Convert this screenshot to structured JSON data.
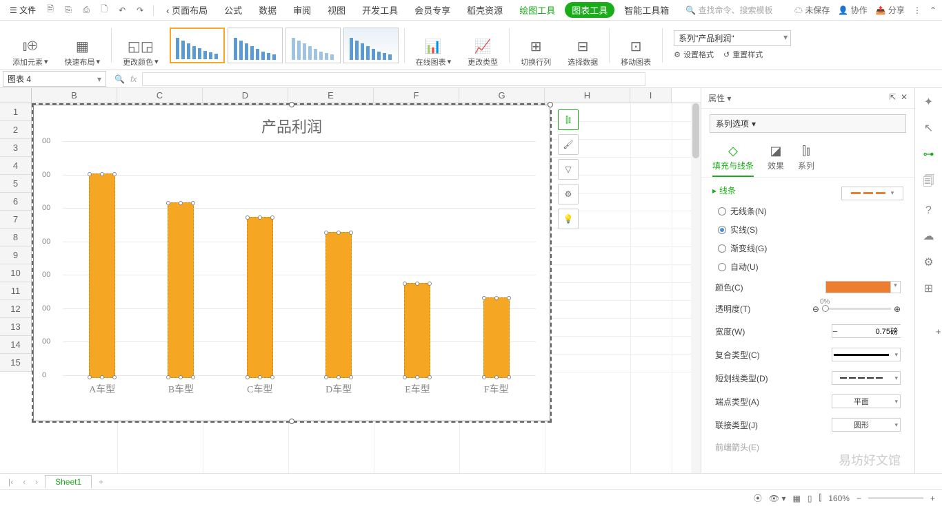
{
  "topbar": {
    "file": "文件",
    "tabs": [
      "页面布局",
      "公式",
      "数据",
      "审阅",
      "视图",
      "开发工具",
      "会员专享",
      "稻壳资源"
    ],
    "draw_tools": "绘图工具",
    "chart_tools": "图表工具",
    "smart_toolbox": "智能工具箱",
    "search_placeholder": "查找命令、搜索模板",
    "unsaved": "未保存",
    "collab": "协作",
    "share": "分享"
  },
  "ribbon": {
    "add_element": "添加元素",
    "quick_layout": "快速布局",
    "change_color": "更改颜色",
    "online_chart": "在线图表",
    "change_type": "更改类型",
    "switch_rc": "切换行列",
    "select_data": "选择数据",
    "move_chart": "移动图表",
    "series_combo": "系列\"产品利润\"",
    "set_format": "设置格式",
    "reset_style": "重置样式"
  },
  "namebox": "图表 4",
  "columns": [
    "B",
    "C",
    "D",
    "E",
    "F",
    "G",
    "H",
    "I"
  ],
  "row_count": 15,
  "chart_data": {
    "type": "bar",
    "title": "产品利润",
    "categories": [
      "A车型",
      "B车型",
      "C车型",
      "D车型",
      "E车型",
      "F车型"
    ],
    "values": [
      14000,
      12000,
      11000,
      10000,
      6500,
      5500
    ],
    "ylabel": "",
    "xlabel": "",
    "ylim": [
      0,
      16000
    ],
    "y_ticks": [
      "00",
      "00",
      "00",
      "00",
      "00",
      "00",
      "00",
      "0"
    ],
    "series_name": "产品利润",
    "series_color": "#f5a623"
  },
  "properties": {
    "header": "属性",
    "series_options": "系列选项",
    "tabs": {
      "fill_line": "填充与线条",
      "effect": "效果",
      "series": "系列"
    },
    "line_section": "线条",
    "line_options": {
      "none": "无线条(N)",
      "solid": "实线(S)",
      "gradient": "渐变线(G)",
      "auto": "自动(U)"
    },
    "selected_line": "solid",
    "color_label": "颜色(C)",
    "color_value": "#ed7d31",
    "transparency_label": "透明度(T)",
    "transparency_value": "0%",
    "width_label": "宽度(W)",
    "width_value": "0.75磅",
    "compound_label": "复合类型(C)",
    "dash_label": "短划线类型(D)",
    "cap_label": "端点类型(A)",
    "cap_value": "平面",
    "join_label": "联接类型(J)",
    "join_value": "圆形",
    "arrow_head_label": "前端箭头(E)"
  },
  "sheet_tab": "Sheet1",
  "zoom": "160%",
  "watermark": "易坊好文馆"
}
